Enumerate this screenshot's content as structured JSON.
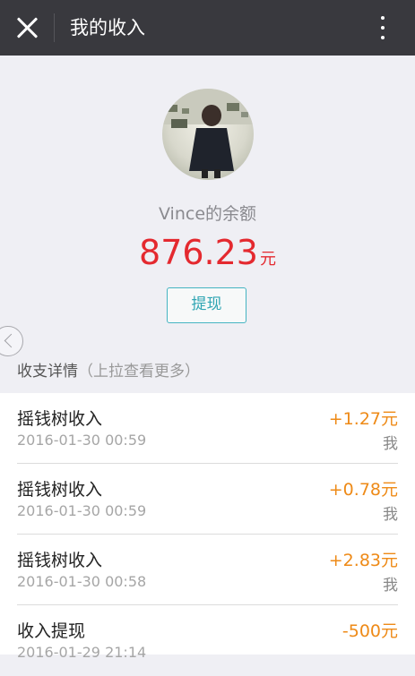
{
  "header": {
    "title": "我的收入",
    "close_icon": "close-icon",
    "more_icon": "more-vertical-icon"
  },
  "profile": {
    "balance_label": "Vince的余额",
    "balance_amount": "876.23",
    "balance_unit": "元",
    "withdraw_label": "提现"
  },
  "details": {
    "title": "收支详情",
    "hint": "（上拉查看更多）"
  },
  "transactions": [
    {
      "title": "摇钱树收入",
      "time": "2016-01-30 00:59",
      "amount": "+1.27元",
      "party": "我"
    },
    {
      "title": "摇钱树收入",
      "time": "2016-01-30 00:59",
      "amount": "+0.78元",
      "party": "我"
    },
    {
      "title": "摇钱树收入",
      "time": "2016-01-30 00:58",
      "amount": "+2.83元",
      "party": "我"
    },
    {
      "title": "收入提现",
      "time": "2016-01-29 21:14",
      "amount": "-500元",
      "party": ""
    }
  ],
  "colors": {
    "topbar": "#39393e",
    "balance": "#e4292f",
    "accent": "#45b4c2",
    "amount": "#ee8a17"
  }
}
